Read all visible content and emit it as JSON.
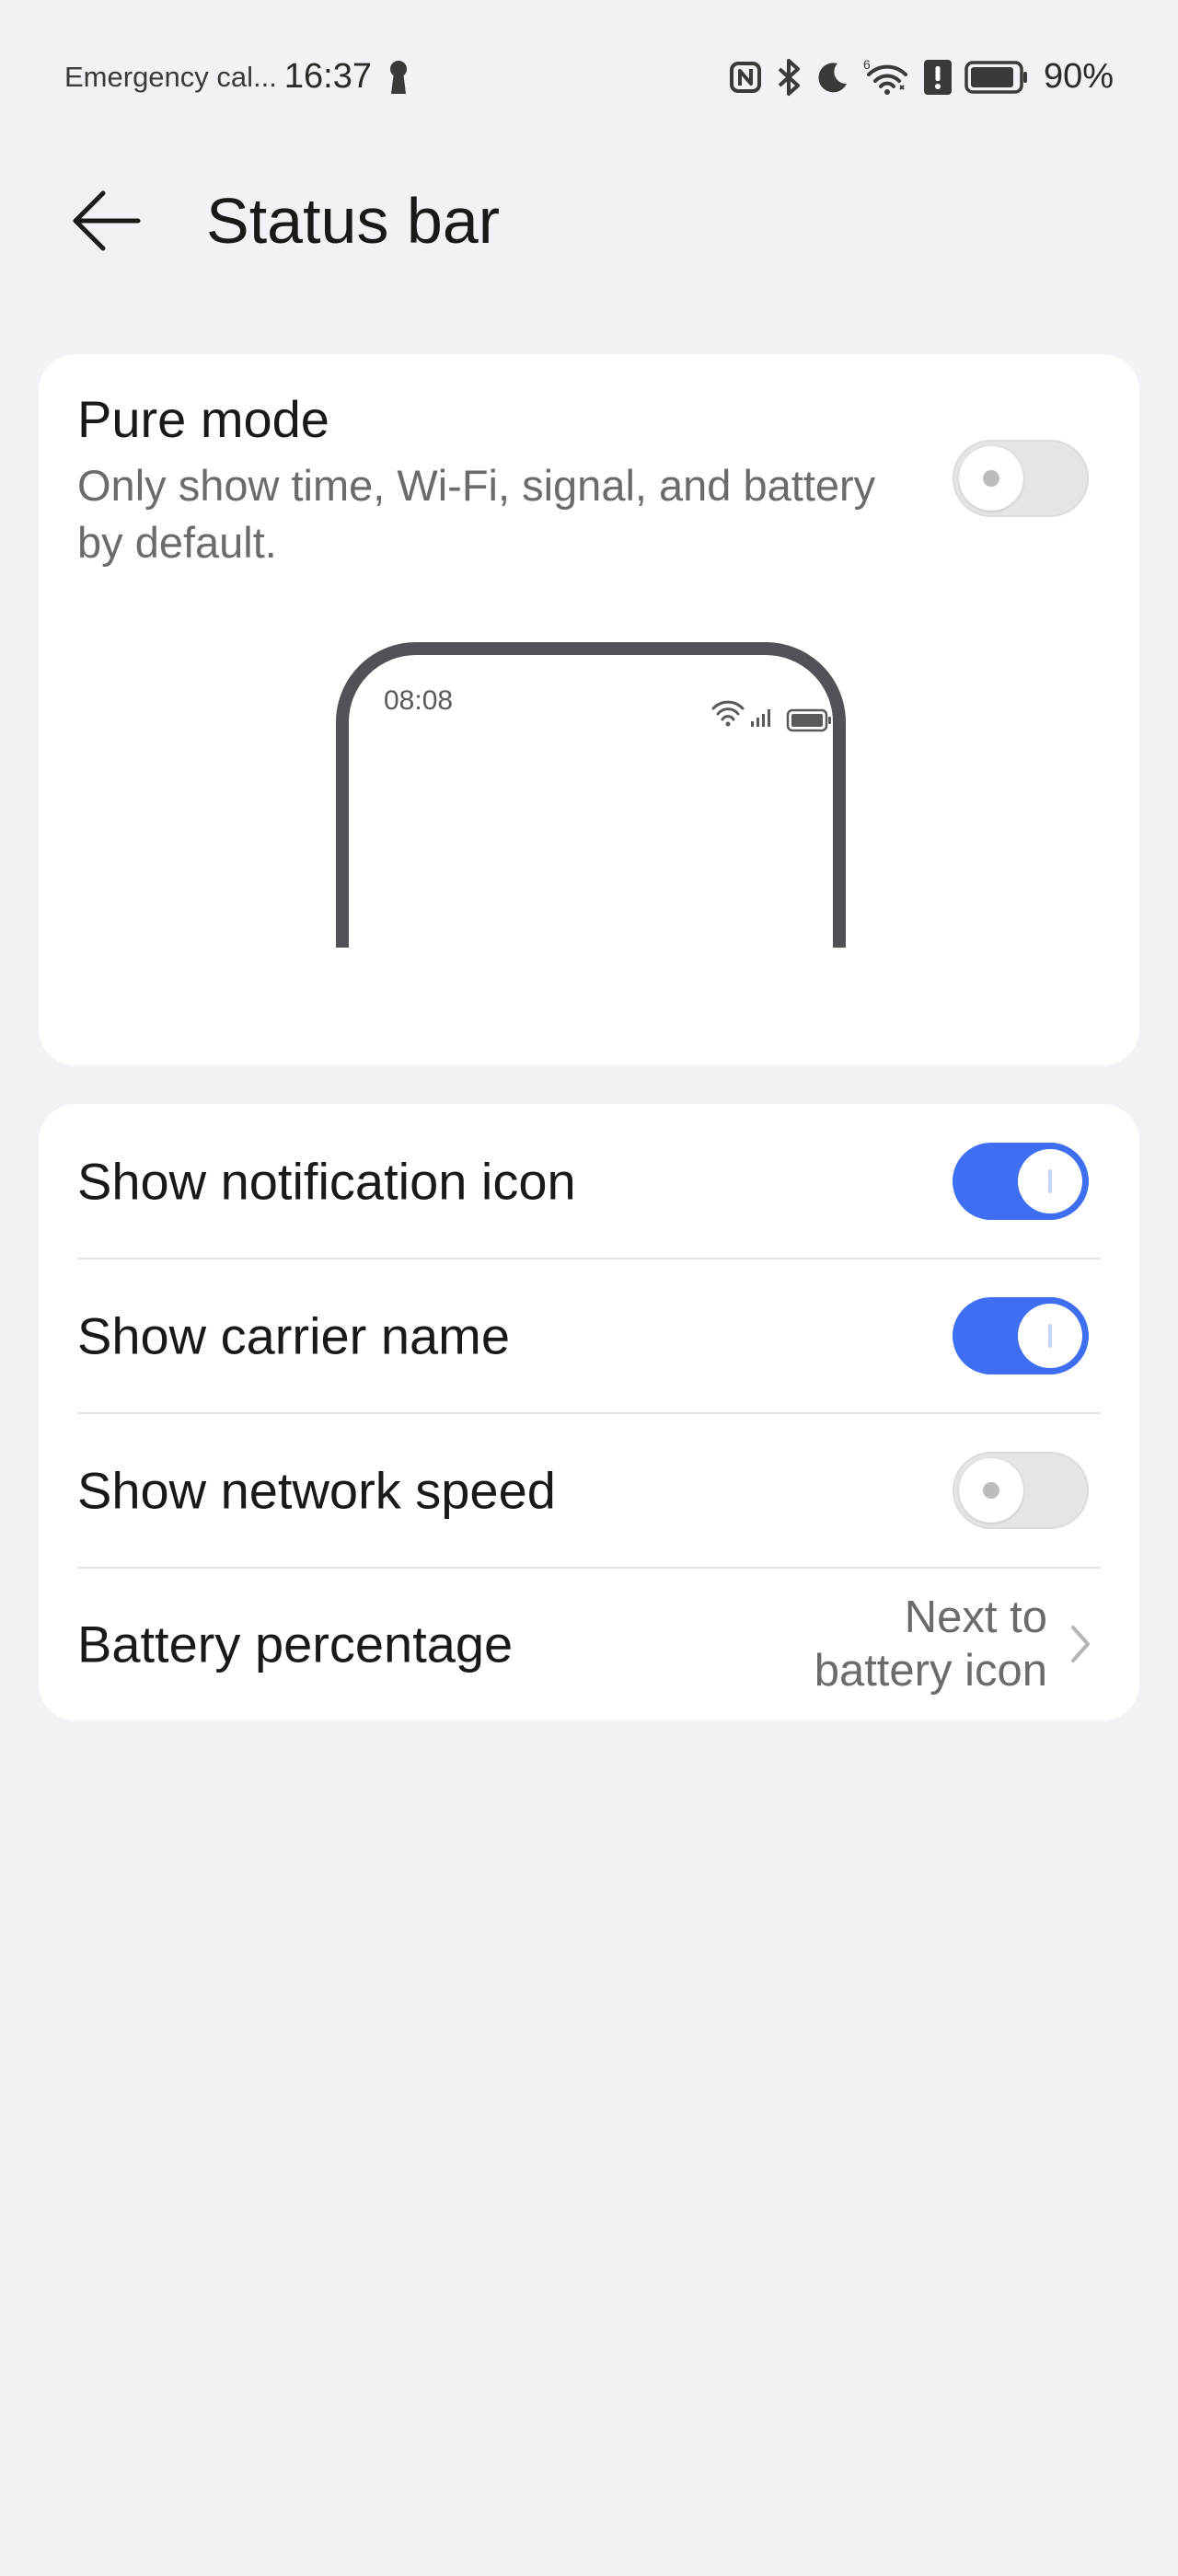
{
  "status_bar": {
    "carrier": "Emergency cal...",
    "time": "16:37",
    "battery_percent": "90%",
    "icons": [
      "keyhole-icon",
      "nfc-icon",
      "bluetooth-icon",
      "moon-icon",
      "wifi-6-icon",
      "alert-icon",
      "battery-icon"
    ]
  },
  "header": {
    "back_icon": "arrow-left-icon",
    "title": "Status bar"
  },
  "pure_mode": {
    "title": "Pure mode",
    "description": "Only show time, Wi-Fi, signal, and battery by default.",
    "enabled": false,
    "preview": {
      "time": "08:08",
      "icons": [
        "wifi-icon",
        "signal-icon",
        "battery-icon"
      ]
    }
  },
  "settings": {
    "items": [
      {
        "label": "Show notification icon",
        "type": "toggle",
        "enabled": true
      },
      {
        "label": "Show carrier name",
        "type": "toggle",
        "enabled": true
      },
      {
        "label": "Show network speed",
        "type": "toggle",
        "enabled": false
      },
      {
        "label": "Battery percentage",
        "type": "link",
        "value_line1": "Next to",
        "value_line2": "battery icon"
      }
    ]
  },
  "colors": {
    "background": "#f1f2f6",
    "card": "#ffffff",
    "accent": "#3e6ff2",
    "toggle_off": "#e5e5e5",
    "secondary_text": "#6b6b6b"
  }
}
